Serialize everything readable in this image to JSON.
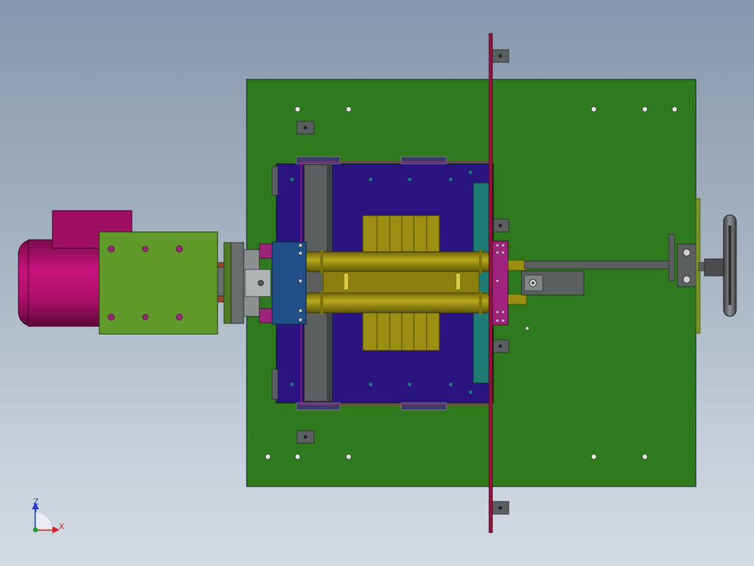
{
  "viewport": {
    "background_top": "#8797ab",
    "background_bottom": "#d3dae2"
  },
  "colors": {
    "base_plate": "#2f7a1f",
    "frame": "#2a1480",
    "motor": "#b0106a",
    "gearbox": "#5f9a2a",
    "rollers": "#9b8e12",
    "bearing_block": "#215089",
    "bracket_magenta": "#a0237c",
    "teal_strip": "#1e7b74",
    "rail_gray": "#5c5f5f",
    "vertical_bar": "#8a1640"
  },
  "triad": {
    "z_label": "Z",
    "x_label": "X",
    "z_color": "#2a3fd0",
    "x_color": "#cc2a2a"
  }
}
